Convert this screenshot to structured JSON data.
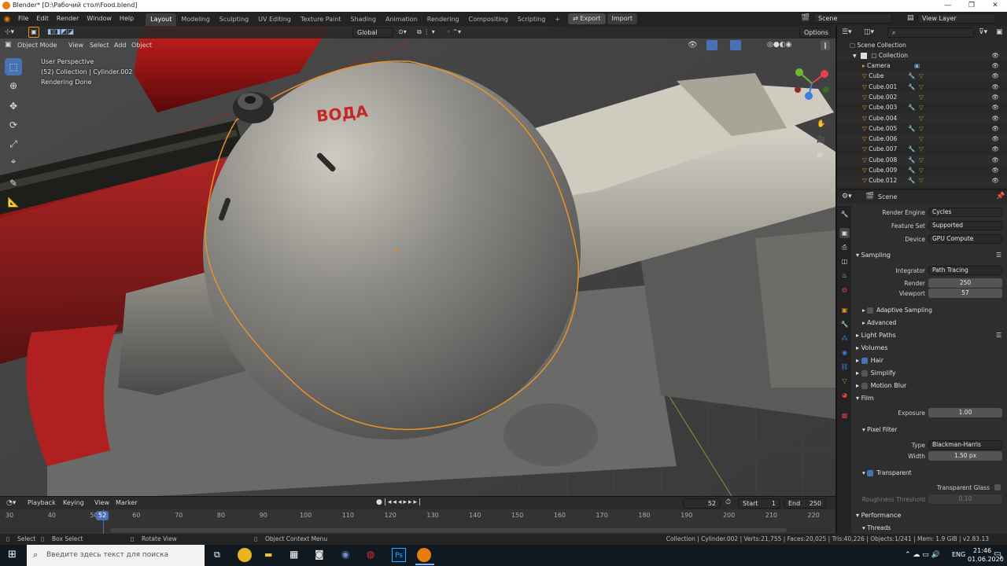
{
  "window": {
    "title": "Blender* [D:\\Рабочий стол\\Food.blend]",
    "controls": [
      "—",
      "❐",
      "✕"
    ]
  },
  "menubar": {
    "menus": [
      "File",
      "Edit",
      "Render",
      "Window",
      "Help"
    ],
    "workspaces": [
      "Layout",
      "Modeling",
      "Sculpting",
      "UV Editing",
      "Texture Paint",
      "Shading",
      "Animation",
      "Rendering",
      "Compositing",
      "Scripting"
    ],
    "active_workspace": "Layout",
    "add_tab": "+",
    "export_label": "Export",
    "import_label": "Import",
    "scene": "Scene",
    "view_layer": "View Layer"
  },
  "viewport": {
    "mode": "Object Mode",
    "menus": [
      "View",
      "Select",
      "Add",
      "Object"
    ],
    "orientation": "Global",
    "options_label": "Options",
    "overlay_lines": [
      "User Perspective",
      "(52) Collection | Cylinder.002",
      "Rendering Done"
    ],
    "emblem_text": "ВОДА"
  },
  "timeline": {
    "menus": [
      "Playback",
      "Keying",
      "View",
      "Marker"
    ],
    "current_frame": "52",
    "start_label": "Start",
    "start": "1",
    "end_label": "End",
    "end": "250",
    "ticks": [
      "30",
      "40",
      "50",
      "60",
      "70",
      "80",
      "90",
      "100",
      "110",
      "120",
      "130",
      "140",
      "150",
      "160",
      "170",
      "180",
      "190",
      "200",
      "210",
      "220"
    ]
  },
  "statusbar": {
    "select": "Select",
    "box_select": "Box Select",
    "rotate_view": "Rotate View",
    "context_menu": "Object Context Menu",
    "stats": "Collection | Cylinder.002 | Verts:21,755 | Faces:20,025 | Tris:40,226 | Objects:1/241 | Mem: 1.9 GiB | v2.83.13"
  },
  "taskbar": {
    "search_placeholder": "Введите здесь текст для поиска",
    "lang": "ENG",
    "time": "21:46",
    "date": "01.06.2020",
    "notif": "3"
  },
  "outliner": {
    "root": "Scene Collection",
    "collection": "Collection",
    "items": [
      "Camera",
      "Cube",
      "Cube.001",
      "Cube.002",
      "Cube.003",
      "Cube.004",
      "Cube.005",
      "Cube.006",
      "Cube.007",
      "Cube.008",
      "Cube.009",
      "Cube.012"
    ]
  },
  "properties": {
    "header": "Scene",
    "render_engine_label": "Render Engine",
    "render_engine": "Cycles",
    "feature_set_label": "Feature Set",
    "feature_set": "Supported",
    "device_label": "Device",
    "device": "GPU Compute",
    "sampling": "Sampling",
    "integrator_label": "Integrator",
    "integrator": "Path Tracing",
    "render_label": "Render",
    "render_samples": "250",
    "viewport_label": "Viewport",
    "viewport_samples": "57",
    "adaptive_sampling": "Adaptive Sampling",
    "advanced": "Advanced",
    "light_paths": "Light Paths",
    "volumes": "Volumes",
    "hair": "Hair",
    "simplify": "Simplify",
    "motion_blur": "Motion Blur",
    "film": "Film",
    "exposure_label": "Exposure",
    "exposure": "1.00",
    "pixel_filter": "Pixel Filter",
    "type_label": "Type",
    "type": "Blackman-Harris",
    "width_label": "Width",
    "width": "1.50 px",
    "transparent": "Transparent",
    "transparent_glass": "Transparent Glass",
    "roughness_threshold_label": "Roughness Threshold",
    "roughness_threshold": "0.10",
    "performance": "Performance",
    "threads": "Threads"
  }
}
